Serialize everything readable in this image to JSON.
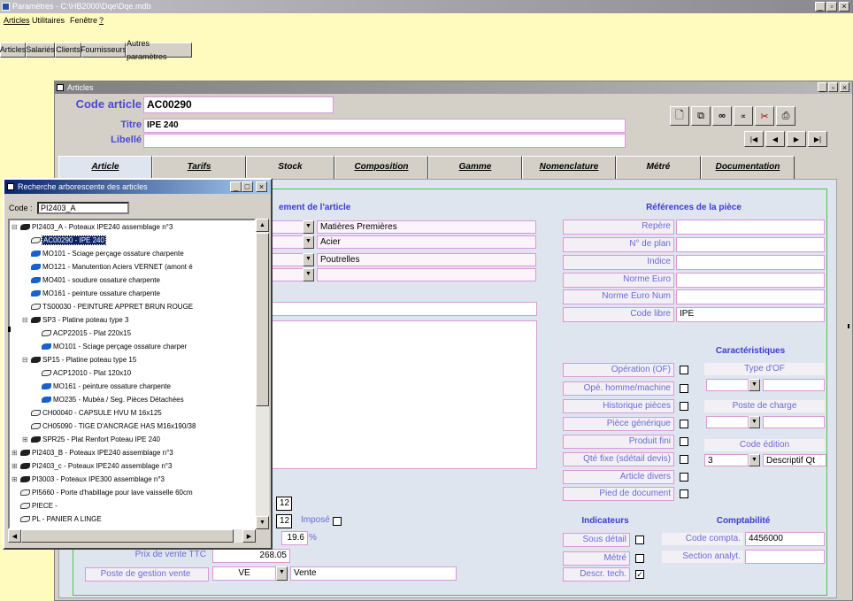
{
  "app": {
    "title": "Paramètres - C:\\HB2000\\Dqe\\Dqe.mdb",
    "menus": [
      "Articles",
      "Utilitaires",
      "Fenêtre",
      "?"
    ],
    "toolbar_tabs": [
      "Articles",
      "Salariés",
      "Clients",
      "Fournisseurs",
      "Autres paramètres"
    ]
  },
  "articles": {
    "title": "Articles",
    "code_label": "Code article",
    "code_value": "AC00290",
    "titre_label": "Titre",
    "titre_value": "IPE 240",
    "libelle_label": "Libellé",
    "libelle_value": "",
    "tabs": [
      "Article",
      "Tarifs",
      "Stock",
      "Composition",
      "Gamme",
      "Nomenclature",
      "Métré",
      "Documentation"
    ],
    "classement_header": "ement de l'article",
    "classement": [
      "Matières Premières",
      "Acier",
      "Poutrelles",
      ""
    ],
    "qty1": "12",
    "qty2": "12",
    "impose_label": "Imposé",
    "tva": "19.6",
    "tva_unit": "%",
    "prix_label": "Prix de vente TTC",
    "prix_value": "268.05",
    "poste_label": "Poste de gestion vente",
    "poste_code": "VE",
    "poste_name": "Vente"
  },
  "references": {
    "header": "Références de la pièce",
    "rows": [
      {
        "label": "Repère",
        "value": ""
      },
      {
        "label": "N° de plan",
        "value": ""
      },
      {
        "label": "Indice",
        "value": ""
      },
      {
        "label": "Norme Euro",
        "value": ""
      },
      {
        "label": "Norme Euro Num",
        "value": ""
      },
      {
        "label": "Code libre",
        "value": "IPE"
      }
    ]
  },
  "caracteristiques": {
    "header": "Caractéristiques",
    "checks": [
      {
        "label": "Opération (OF)",
        "checked": false
      },
      {
        "label": "Opé. homme/machine",
        "checked": false
      },
      {
        "label": "Historique pièces",
        "checked": false
      },
      {
        "label": "Pièce générique",
        "checked": false
      },
      {
        "label": "Produit fini",
        "checked": false
      },
      {
        "label": "Qté fixe (sdétail devis)",
        "checked": false
      },
      {
        "label": "Article divers",
        "checked": false
      },
      {
        "label": "Pied de document",
        "checked": false
      }
    ],
    "type_of_label": "Type d'OF",
    "poste_charge_label": "Poste de charge",
    "code_edition_label": "Code édition",
    "code_edition_num": "3",
    "code_edition_value": "Descriptif Qt"
  },
  "indicateurs": {
    "header": "Indicateurs",
    "rows": [
      {
        "label": "Sous détail",
        "checked": false
      },
      {
        "label": "Métré",
        "checked": false
      },
      {
        "label": "Descr. tech.",
        "checked": true
      }
    ]
  },
  "comptabilite": {
    "header": "Comptabilité",
    "compte_label": "Code compta.",
    "compte_value": "4456000",
    "section_label": "Section analyt.",
    "section_value": ""
  },
  "tree": {
    "title": "Recherche arborescente des articles",
    "code_label": "Code :",
    "code_value": "PI2403_A",
    "items": [
      {
        "indent": 0,
        "exp": "⊟",
        "icon": "black",
        "text": "PI2403_A - Poteaux IPE240 assemblage n°3"
      },
      {
        "indent": 1,
        "exp": "",
        "icon": "open",
        "text": "AC00290 - IPE 240",
        "selected": true
      },
      {
        "indent": 1,
        "exp": "",
        "icon": "blue",
        "text": "MO101 - Sciage perçage ossature charpente"
      },
      {
        "indent": 1,
        "exp": "",
        "icon": "blue",
        "text": "MO121 - Manutention Aciers VERNET (amont é"
      },
      {
        "indent": 1,
        "exp": "",
        "icon": "blue",
        "text": "MO401 - soudure ossature charpente"
      },
      {
        "indent": 1,
        "exp": "",
        "icon": "blue",
        "text": "MO161 - peinture ossature charpente"
      },
      {
        "indent": 1,
        "exp": "",
        "icon": "open",
        "text": "TS00030 - PEINTURE APPRET BRUN ROUGE"
      },
      {
        "indent": 1,
        "exp": "⊟",
        "icon": "black",
        "text": "SP3 - Platine poteau type 3"
      },
      {
        "indent": 2,
        "exp": "",
        "icon": "open",
        "text": "ACP22015 - Plat 220x15"
      },
      {
        "indent": 2,
        "exp": "",
        "icon": "blue",
        "text": "MO101 - Sciage perçage ossature charper"
      },
      {
        "indent": 1,
        "exp": "⊟",
        "icon": "black",
        "text": "SP15 - Platine poteau type 15"
      },
      {
        "indent": 2,
        "exp": "",
        "icon": "open",
        "text": "ACP12010 - Plat 120x10"
      },
      {
        "indent": 2,
        "exp": "",
        "icon": "blue",
        "text": "MO161 - peinture ossature charpente"
      },
      {
        "indent": 2,
        "exp": "",
        "icon": "blue",
        "text": "MO235 - Mubéa / Seg. Pièces Détachées"
      },
      {
        "indent": 1,
        "exp": "",
        "icon": "open",
        "text": "CH00040 - CAPSULE HVU M 16x125"
      },
      {
        "indent": 1,
        "exp": "",
        "icon": "open",
        "text": "CH05090 - TIGE D'ANCRAGE HAS M16x190/38"
      },
      {
        "indent": 1,
        "exp": "⊞",
        "icon": "black",
        "text": "SPR25 - Plat Renfort Poteau IPE 240"
      },
      {
        "indent": 0,
        "exp": "⊞",
        "icon": "black",
        "text": "PI2403_B - Poteaux IPE240 assemblage n°3"
      },
      {
        "indent": 0,
        "exp": "⊞",
        "icon": "black",
        "text": "PI2403_c - Poteaux IPE240 assemblage n°3"
      },
      {
        "indent": 0,
        "exp": "⊞",
        "icon": "black",
        "text": "PI3003 - Poteaux IPE300 assemblage n°3"
      },
      {
        "indent": 0,
        "exp": "",
        "icon": "open",
        "text": "PI5660 - Porte d'habillage pour lave vaisselle 60cm"
      },
      {
        "indent": 0,
        "exp": "",
        "icon": "open",
        "text": "PIECE -"
      },
      {
        "indent": 0,
        "exp": "",
        "icon": "open",
        "text": "PL - PANIER A LINGE"
      }
    ]
  },
  "icons": {
    "new": "new-document-icon",
    "copy": "copy-icon",
    "find": "binoculars-icon",
    "link": "link-icon",
    "cut": "scissors-icon",
    "print": "printer-icon",
    "first": "first-record-icon",
    "prev": "prev-record-icon",
    "next": "next-record-icon",
    "last": "last-record-icon"
  }
}
